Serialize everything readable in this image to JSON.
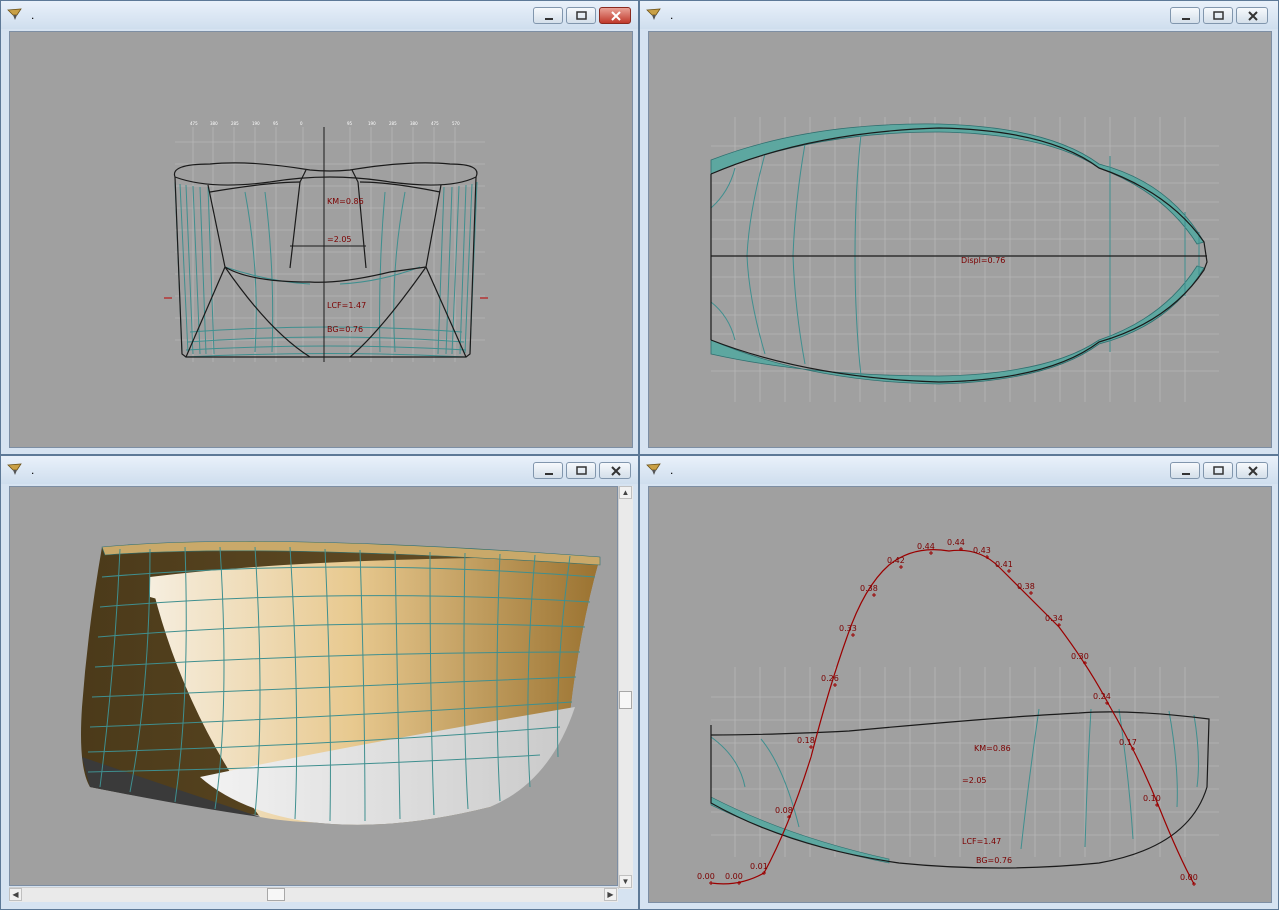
{
  "windows": [
    {
      "id": "front",
      "title": "."
    },
    {
      "id": "plan",
      "title": "."
    },
    {
      "id": "render",
      "title": "."
    },
    {
      "id": "profile",
      "title": "."
    }
  ],
  "hydro_labels": {
    "km": "KM=0.86",
    "kb": "=2.05",
    "lcf": "LCF=1.47",
    "bg": "BG=0.76"
  },
  "plan_label": "Displ=0.76",
  "curve_values": [
    "0.00",
    "0.00",
    "0.01",
    "0.08",
    "0.18",
    "0.26",
    "0.33",
    "0.38",
    "0.42",
    "0.44",
    "0.44",
    "0.43",
    "0.41",
    "0.38",
    "0.34",
    "0.30",
    "0.24",
    "0.17",
    "0.10",
    "0.00"
  ],
  "colors": {
    "teal": "#3f8f8f",
    "curve": "#9b0000",
    "view_bg": "#a0a0a0"
  }
}
